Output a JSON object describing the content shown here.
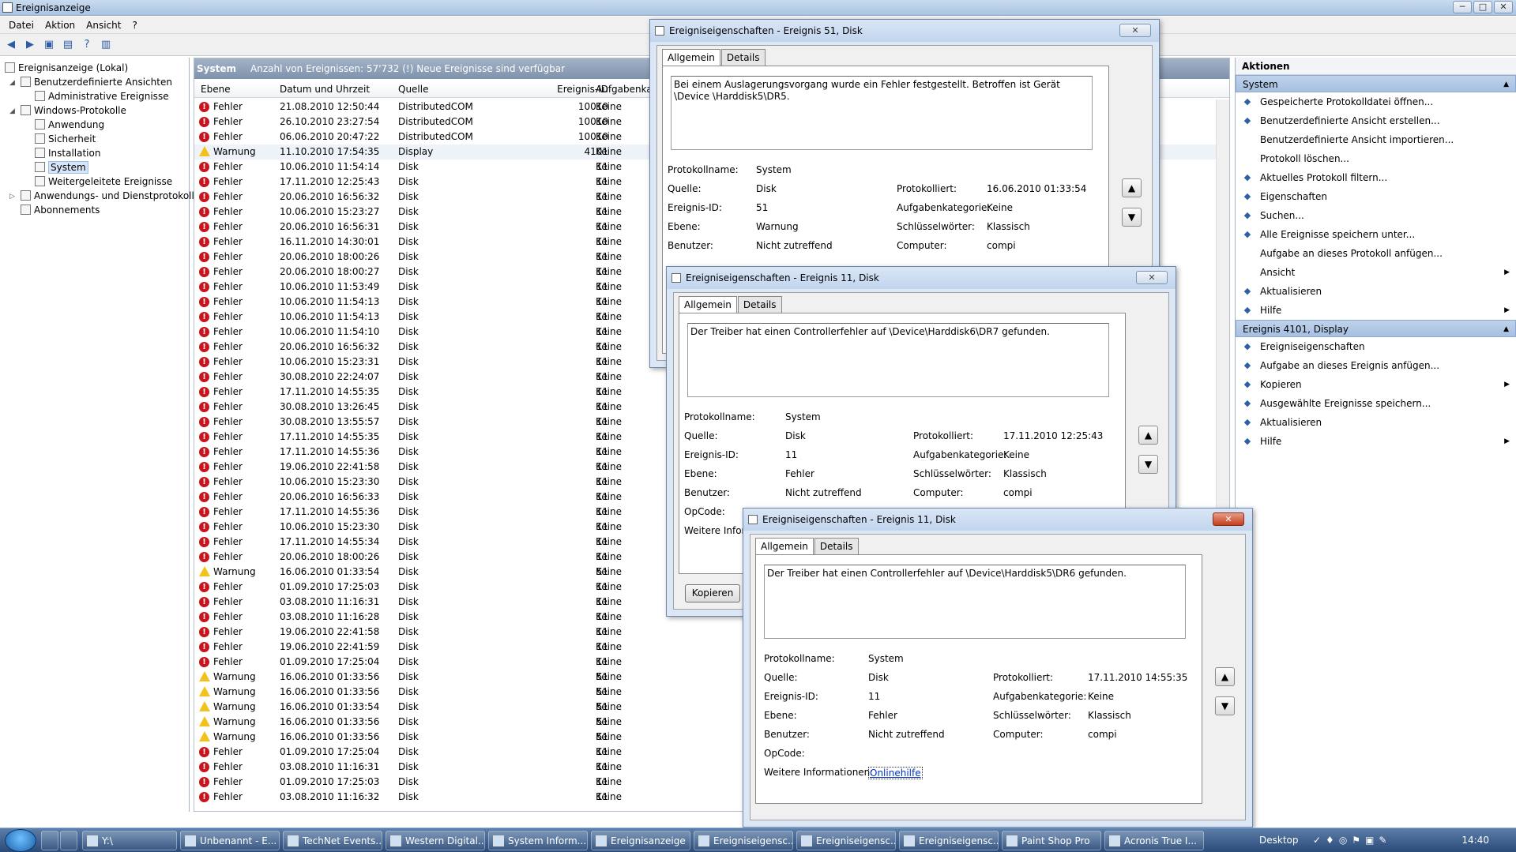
{
  "app": {
    "title": "Ereignisanzeige"
  },
  "menu": [
    "Datei",
    "Aktion",
    "Ansicht",
    "?"
  ],
  "window_buttons": [
    "─",
    "□",
    "✕"
  ],
  "tree": {
    "root": "Ereignisanzeige (Lokal)",
    "custom_views": "Benutzerdefinierte Ansichten",
    "admin_events": "Administrative Ereignisse",
    "windows_logs": "Windows-Protokolle",
    "logs": [
      "Anwendung",
      "Sicherheit",
      "Installation",
      "System",
      "Weitergeleitete Ereignisse"
    ],
    "app_service_logs": "Anwendungs- und Dienstprotokolle",
    "subscriptions": "Abonnements"
  },
  "center": {
    "log_name": "System",
    "summary": "Anzahl von Ereignissen: 57'732 (!) Neue Ereignisse sind verfügbar",
    "columns": [
      "Ebene",
      "Datum und Uhrzeit",
      "Quelle",
      "Ereignis-ID",
      "Aufgabenkat"
    ],
    "rows": [
      [
        "Fehler",
        "21.08.2010 12:50:44",
        "DistributedCOM",
        "10010",
        "Keine"
      ],
      [
        "Fehler",
        "26.10.2010 23:27:54",
        "DistributedCOM",
        "10010",
        "Keine"
      ],
      [
        "Fehler",
        "06.06.2010 20:47:22",
        "DistributedCOM",
        "10010",
        "Keine"
      ],
      [
        "Warnung",
        "11.10.2010 17:54:35",
        "Display",
        "4101",
        "Keine"
      ],
      [
        "Fehler",
        "10.06.2010 11:54:14",
        "Disk",
        "11",
        "Keine"
      ],
      [
        "Fehler",
        "17.11.2010 12:25:43",
        "Disk",
        "11",
        "Keine"
      ],
      [
        "Fehler",
        "20.06.2010 16:56:32",
        "Disk",
        "11",
        "Keine"
      ],
      [
        "Fehler",
        "10.06.2010 15:23:27",
        "Disk",
        "11",
        "Keine"
      ],
      [
        "Fehler",
        "20.06.2010 16:56:31",
        "Disk",
        "11",
        "Keine"
      ],
      [
        "Fehler",
        "16.11.2010 14:30:01",
        "Disk",
        "11",
        "Keine"
      ],
      [
        "Fehler",
        "20.06.2010 18:00:26",
        "Disk",
        "11",
        "Keine"
      ],
      [
        "Fehler",
        "20.06.2010 18:00:27",
        "Disk",
        "11",
        "Keine"
      ],
      [
        "Fehler",
        "10.06.2010 11:53:49",
        "Disk",
        "11",
        "Keine"
      ],
      [
        "Fehler",
        "10.06.2010 11:54:13",
        "Disk",
        "11",
        "Keine"
      ],
      [
        "Fehler",
        "10.06.2010 11:54:13",
        "Disk",
        "11",
        "Keine"
      ],
      [
        "Fehler",
        "10.06.2010 11:54:10",
        "Disk",
        "11",
        "Keine"
      ],
      [
        "Fehler",
        "20.06.2010 16:56:32",
        "Disk",
        "11",
        "Keine"
      ],
      [
        "Fehler",
        "10.06.2010 15:23:31",
        "Disk",
        "11",
        "Keine"
      ],
      [
        "Fehler",
        "30.08.2010 22:24:07",
        "Disk",
        "11",
        "Keine"
      ],
      [
        "Fehler",
        "17.11.2010 14:55:35",
        "Disk",
        "11",
        "Keine"
      ],
      [
        "Fehler",
        "30.08.2010 13:26:45",
        "Disk",
        "11",
        "Keine"
      ],
      [
        "Fehler",
        "30.08.2010 13:55:57",
        "Disk",
        "11",
        "Keine"
      ],
      [
        "Fehler",
        "17.11.2010 14:55:35",
        "Disk",
        "11",
        "Keine"
      ],
      [
        "Fehler",
        "17.11.2010 14:55:36",
        "Disk",
        "11",
        "Keine"
      ],
      [
        "Fehler",
        "19.06.2010 22:41:58",
        "Disk",
        "11",
        "Keine"
      ],
      [
        "Fehler",
        "10.06.2010 15:23:30",
        "Disk",
        "11",
        "Keine"
      ],
      [
        "Fehler",
        "20.06.2010 16:56:33",
        "Disk",
        "11",
        "Keine"
      ],
      [
        "Fehler",
        "17.11.2010 14:55:36",
        "Disk",
        "11",
        "Keine"
      ],
      [
        "Fehler",
        "10.06.2010 15:23:30",
        "Disk",
        "11",
        "Keine"
      ],
      [
        "Fehler",
        "17.11.2010 14:55:34",
        "Disk",
        "11",
        "Keine"
      ],
      [
        "Fehler",
        "20.06.2010 18:00:26",
        "Disk",
        "11",
        "Keine"
      ],
      [
        "Warnung",
        "16.06.2010 01:33:54",
        "Disk",
        "51",
        "Keine"
      ],
      [
        "Fehler",
        "01.09.2010 17:25:03",
        "Disk",
        "11",
        "Keine"
      ],
      [
        "Fehler",
        "03.08.2010 11:16:31",
        "Disk",
        "11",
        "Keine"
      ],
      [
        "Fehler",
        "03.08.2010 11:16:28",
        "Disk",
        "11",
        "Keine"
      ],
      [
        "Fehler",
        "19.06.2010 22:41:58",
        "Disk",
        "11",
        "Keine"
      ],
      [
        "Fehler",
        "19.06.2010 22:41:59",
        "Disk",
        "11",
        "Keine"
      ],
      [
        "Fehler",
        "01.09.2010 17:25:04",
        "Disk",
        "11",
        "Keine"
      ],
      [
        "Warnung",
        "16.06.2010 01:33:56",
        "Disk",
        "51",
        "Keine"
      ],
      [
        "Warnung",
        "16.06.2010 01:33:56",
        "Disk",
        "51",
        "Keine"
      ],
      [
        "Warnung",
        "16.06.2010 01:33:54",
        "Disk",
        "51",
        "Keine"
      ],
      [
        "Warnung",
        "16.06.2010 01:33:56",
        "Disk",
        "51",
        "Keine"
      ],
      [
        "Warnung",
        "16.06.2010 01:33:56",
        "Disk",
        "51",
        "Keine"
      ],
      [
        "Fehler",
        "01.09.2010 17:25:04",
        "Disk",
        "11",
        "Keine"
      ],
      [
        "Fehler",
        "03.08.2010 11:16:31",
        "Disk",
        "11",
        "Keine"
      ],
      [
        "Fehler",
        "01.09.2010 17:25:03",
        "Disk",
        "11",
        "Keine"
      ],
      [
        "Fehler",
        "03.08.2010 11:16:32",
        "Disk",
        "11",
        "Keine"
      ]
    ]
  },
  "actions": {
    "header": "Aktionen",
    "section1": "System",
    "items1": [
      {
        "label": "Gespeicherte Protokolldatei öffnen...",
        "icon": "open-log-icon"
      },
      {
        "label": "Benutzerdefinierte Ansicht erstellen...",
        "icon": "filter-icon"
      },
      {
        "label": "Benutzerdefinierte Ansicht importieren...",
        "icon": ""
      },
      {
        "label": "Protokoll löschen...",
        "icon": ""
      },
      {
        "label": "Aktuelles Protokoll filtern...",
        "icon": "filter-icon"
      },
      {
        "label": "Eigenschaften",
        "icon": "properties-icon"
      },
      {
        "label": "Suchen...",
        "icon": "find-icon"
      },
      {
        "label": "Alle Ereignisse speichern unter...",
        "icon": "save-icon"
      },
      {
        "label": "Aufgabe an dieses Protokoll anfügen...",
        "icon": ""
      },
      {
        "label": "Ansicht",
        "icon": "",
        "sub": true
      },
      {
        "label": "Aktualisieren",
        "icon": "refresh-icon"
      },
      {
        "label": "Hilfe",
        "icon": "help-icon",
        "sub": true
      }
    ],
    "section2": "Ereignis 4101, Display",
    "items2": [
      {
        "label": "Ereigniseigenschaften",
        "icon": "event-properties-icon"
      },
      {
        "label": "Aufgabe an dieses Ereignis anfügen...",
        "icon": "task-icon"
      },
      {
        "label": "Kopieren",
        "icon": "copy-icon",
        "sub": true
      },
      {
        "label": "Ausgewählte Ereignisse speichern...",
        "icon": "save-icon"
      },
      {
        "label": "Aktualisieren",
        "icon": "refresh-icon"
      },
      {
        "label": "Hilfe",
        "icon": "help-icon",
        "sub": true
      }
    ]
  },
  "field_labels": {
    "logname": "Protokollname:",
    "source": "Quelle:",
    "eventid": "Ereignis-ID:",
    "level": "Ebene:",
    "user": "Benutzer:",
    "opcode": "OpCode:",
    "moreinfo": "Weitere Informationen:",
    "logged": "Protokolliert:",
    "taskcat": "Aufgabenkategorie:",
    "keywords": "Schlüsselwörter:",
    "computer": "Computer:"
  },
  "dialogs": [
    {
      "title": "Ereigniseigenschaften - Ereignis 51, Disk",
      "tab_general": "Allgemein",
      "tab_details": "Details",
      "message": "Bei einem Auslagerungsvorgang wurde ein Fehler festgestellt. Betroffen ist Gerät \\Device \\Harddisk5\\DR5.",
      "logname": "System",
      "source": "Disk",
      "eventid": "51",
      "level": "Warnung",
      "user": "Nicht zutreffend",
      "logged": "16.06.2010 01:33:54",
      "taskcat": "Keine",
      "keywords": "Klassisch",
      "computer": "compi"
    },
    {
      "title": "Ereigniseigenschaften - Ereignis 11, Disk",
      "tab_general": "Allgemein",
      "tab_details": "Details",
      "message": "Der Treiber hat einen Controllerfehler auf \\Device\\Harddisk6\\DR7 gefunden.",
      "logname": "System",
      "source": "Disk",
      "eventid": "11",
      "level": "Fehler",
      "user": "Nicht zutreffend",
      "logged": "17.11.2010 12:25:43",
      "taskcat": "Keine",
      "keywords": "Klassisch",
      "computer": "compi",
      "moreinfo_partial": "Weitere Infor",
      "copy": "Kopieren"
    },
    {
      "title": "Ereigniseigenschaften - Ereignis 11, Disk",
      "tab_general": "Allgemein",
      "tab_details": "Details",
      "message": "Der Treiber hat einen Controllerfehler auf \\Device\\Harddisk5\\DR6 gefunden.",
      "logname": "System",
      "source": "Disk",
      "eventid": "11",
      "level": "Fehler",
      "user": "Nicht zutreffend",
      "logged": "17.11.2010 14:55:35",
      "taskcat": "Keine",
      "keywords": "Klassisch",
      "computer": "compi",
      "link": "Onlinehilfe"
    }
  ],
  "taskbar": {
    "tasks": [
      "Y:\\",
      "Unbenannt - E...",
      "TechNet Events...",
      "Western Digital...",
      "System Inform...",
      "Ereignisanzeige",
      "Ereigniseigensc...",
      "Ereigniseigensc...",
      "Ereigniseigensc...",
      "Paint Shop Pro",
      "Acronis True I..."
    ],
    "desktop": "Desktop",
    "clock": "14:40"
  },
  "colors": {
    "error": "#c8141c",
    "warning": "#f2c21b",
    "accent": "#a6c0e2"
  }
}
